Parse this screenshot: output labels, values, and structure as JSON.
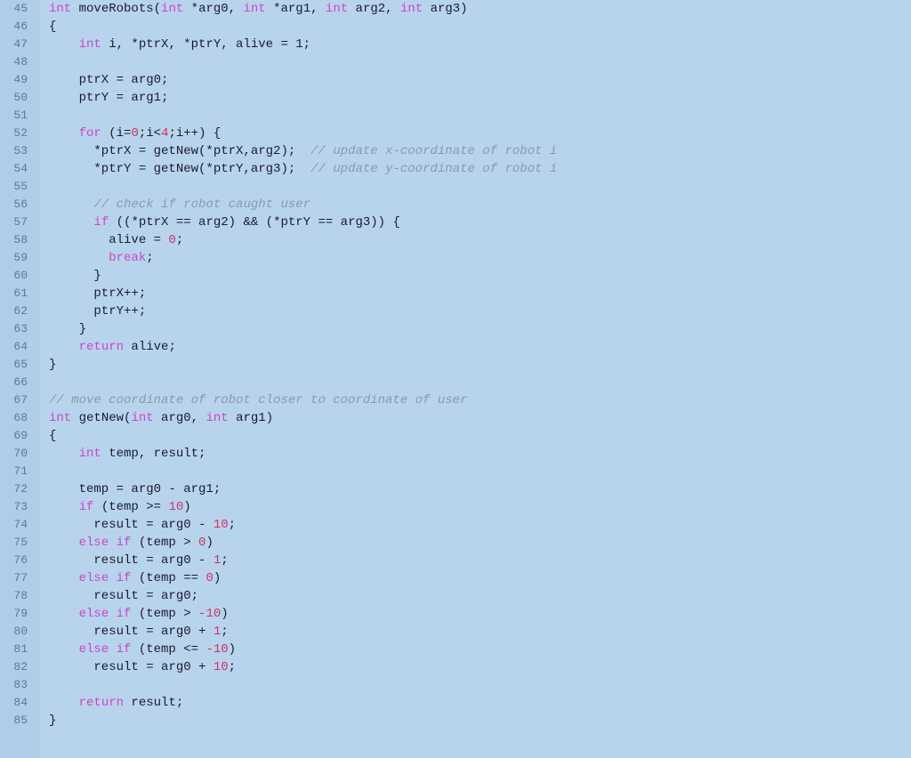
{
  "editor": {
    "background": "#b8d4ed",
    "lines": [
      {
        "num": 45,
        "tokens": [
          {
            "t": "kw",
            "v": "int"
          },
          {
            "t": "plain",
            "v": " moveRobots("
          },
          {
            "t": "kw",
            "v": "int"
          },
          {
            "t": "plain",
            "v": " *arg0, "
          },
          {
            "t": "kw",
            "v": "int"
          },
          {
            "t": "plain",
            "v": " *arg1, "
          },
          {
            "t": "kw",
            "v": "int"
          },
          {
            "t": "plain",
            "v": " arg2, "
          },
          {
            "t": "kw",
            "v": "int"
          },
          {
            "t": "plain",
            "v": " arg3)"
          }
        ]
      },
      {
        "num": 46,
        "tokens": [
          {
            "t": "plain",
            "v": "{"
          }
        ]
      },
      {
        "num": 47,
        "tokens": [
          {
            "t": "plain",
            "v": "    "
          },
          {
            "t": "kw",
            "v": "int"
          },
          {
            "t": "plain",
            "v": " i, *ptrX, *ptrY, alive = 1;"
          }
        ]
      },
      {
        "num": 48,
        "tokens": []
      },
      {
        "num": 49,
        "tokens": [
          {
            "t": "plain",
            "v": "    ptrX = arg0;"
          }
        ]
      },
      {
        "num": 50,
        "tokens": [
          {
            "t": "plain",
            "v": "    ptrY = arg1;"
          }
        ]
      },
      {
        "num": 51,
        "tokens": []
      },
      {
        "num": 52,
        "tokens": [
          {
            "t": "plain",
            "v": "    "
          },
          {
            "t": "kw",
            "v": "for"
          },
          {
            "t": "plain",
            "v": " (i="
          },
          {
            "t": "num",
            "v": "0"
          },
          {
            "t": "plain",
            "v": ";i<"
          },
          {
            "t": "num",
            "v": "4"
          },
          {
            "t": "plain",
            "v": ";i++) {"
          }
        ]
      },
      {
        "num": 53,
        "tokens": [
          {
            "t": "plain",
            "v": "      *ptrX = getNew(*ptrX,arg2);  "
          },
          {
            "t": "cm",
            "v": "// update x-coordinate of robot i"
          }
        ]
      },
      {
        "num": 54,
        "tokens": [
          {
            "t": "plain",
            "v": "      *ptrY = getNew(*ptrY,arg3);  "
          },
          {
            "t": "cm",
            "v": "// update y-coordinate of robot i"
          }
        ]
      },
      {
        "num": 55,
        "tokens": []
      },
      {
        "num": 56,
        "tokens": [
          {
            "t": "plain",
            "v": "      "
          },
          {
            "t": "cm",
            "v": "// check if robot caught user"
          }
        ]
      },
      {
        "num": 57,
        "tokens": [
          {
            "t": "plain",
            "v": "      "
          },
          {
            "t": "kw",
            "v": "if"
          },
          {
            "t": "plain",
            "v": " ((*ptrX == arg2) && (*ptrY == arg3)) {"
          }
        ]
      },
      {
        "num": 58,
        "tokens": [
          {
            "t": "plain",
            "v": "        alive = "
          },
          {
            "t": "num",
            "v": "0"
          },
          {
            "t": "plain",
            "v": ";"
          }
        ]
      },
      {
        "num": 59,
        "tokens": [
          {
            "t": "plain",
            "v": "        "
          },
          {
            "t": "kw",
            "v": "break"
          },
          {
            "t": "plain",
            "v": ";"
          }
        ]
      },
      {
        "num": 60,
        "tokens": [
          {
            "t": "plain",
            "v": "      }"
          }
        ]
      },
      {
        "num": 61,
        "tokens": [
          {
            "t": "plain",
            "v": "      ptrX++;"
          }
        ]
      },
      {
        "num": 62,
        "tokens": [
          {
            "t": "plain",
            "v": "      ptrY++;"
          }
        ]
      },
      {
        "num": 63,
        "tokens": [
          {
            "t": "plain",
            "v": "    }"
          }
        ]
      },
      {
        "num": 64,
        "tokens": [
          {
            "t": "plain",
            "v": "    "
          },
          {
            "t": "kw",
            "v": "return"
          },
          {
            "t": "plain",
            "v": " alive;"
          }
        ]
      },
      {
        "num": 65,
        "tokens": [
          {
            "t": "plain",
            "v": "}"
          }
        ]
      },
      {
        "num": 66,
        "tokens": []
      },
      {
        "num": 67,
        "tokens": [
          {
            "t": "cm",
            "v": "// move coordinate of robot closer to coordinate of user"
          }
        ]
      },
      {
        "num": 68,
        "tokens": [
          {
            "t": "kw",
            "v": "int"
          },
          {
            "t": "plain",
            "v": " getNew("
          },
          {
            "t": "kw",
            "v": "int"
          },
          {
            "t": "plain",
            "v": " arg0, "
          },
          {
            "t": "kw",
            "v": "int"
          },
          {
            "t": "plain",
            "v": " arg1)"
          }
        ]
      },
      {
        "num": 69,
        "tokens": [
          {
            "t": "plain",
            "v": "{"
          }
        ]
      },
      {
        "num": 70,
        "tokens": [
          {
            "t": "plain",
            "v": "    "
          },
          {
            "t": "kw",
            "v": "int"
          },
          {
            "t": "plain",
            "v": " temp, result;"
          }
        ]
      },
      {
        "num": 71,
        "tokens": []
      },
      {
        "num": 72,
        "tokens": [
          {
            "t": "plain",
            "v": "    temp = arg0 - arg1;"
          }
        ]
      },
      {
        "num": 73,
        "tokens": [
          {
            "t": "plain",
            "v": "    "
          },
          {
            "t": "kw",
            "v": "if"
          },
          {
            "t": "plain",
            "v": " (temp >= "
          },
          {
            "t": "num",
            "v": "10"
          },
          {
            "t": "plain",
            "v": ")"
          }
        ]
      },
      {
        "num": 74,
        "tokens": [
          {
            "t": "plain",
            "v": "      result = arg0 - "
          },
          {
            "t": "num",
            "v": "10"
          },
          {
            "t": "plain",
            "v": ";"
          }
        ]
      },
      {
        "num": 75,
        "tokens": [
          {
            "t": "plain",
            "v": "    "
          },
          {
            "t": "kw",
            "v": "else if"
          },
          {
            "t": "plain",
            "v": " (temp > "
          },
          {
            "t": "num",
            "v": "0"
          },
          {
            "t": "plain",
            "v": ")"
          }
        ]
      },
      {
        "num": 76,
        "tokens": [
          {
            "t": "plain",
            "v": "      result = arg0 - "
          },
          {
            "t": "num",
            "v": "1"
          },
          {
            "t": "plain",
            "v": ";"
          }
        ]
      },
      {
        "num": 77,
        "tokens": [
          {
            "t": "plain",
            "v": "    "
          },
          {
            "t": "kw",
            "v": "else if"
          },
          {
            "t": "plain",
            "v": " (temp == "
          },
          {
            "t": "num",
            "v": "0"
          },
          {
            "t": "plain",
            "v": ")"
          }
        ]
      },
      {
        "num": 78,
        "tokens": [
          {
            "t": "plain",
            "v": "      result = arg0;"
          }
        ]
      },
      {
        "num": 79,
        "tokens": [
          {
            "t": "plain",
            "v": "    "
          },
          {
            "t": "kw",
            "v": "else if"
          },
          {
            "t": "plain",
            "v": " (temp > "
          },
          {
            "t": "num",
            "v": "-10"
          },
          {
            "t": "plain",
            "v": ")"
          }
        ]
      },
      {
        "num": 80,
        "tokens": [
          {
            "t": "plain",
            "v": "      result = arg0 + "
          },
          {
            "t": "num",
            "v": "1"
          },
          {
            "t": "plain",
            "v": ";"
          }
        ]
      },
      {
        "num": 81,
        "tokens": [
          {
            "t": "plain",
            "v": "    "
          },
          {
            "t": "kw",
            "v": "else if"
          },
          {
            "t": "plain",
            "v": " (temp <= "
          },
          {
            "t": "num",
            "v": "-10"
          },
          {
            "t": "plain",
            "v": ")"
          }
        ]
      },
      {
        "num": 82,
        "tokens": [
          {
            "t": "plain",
            "v": "      result = arg0 + "
          },
          {
            "t": "num",
            "v": "10"
          },
          {
            "t": "plain",
            "v": ";"
          }
        ]
      },
      {
        "num": 83,
        "tokens": []
      },
      {
        "num": 84,
        "tokens": [
          {
            "t": "plain",
            "v": "    "
          },
          {
            "t": "kw",
            "v": "return"
          },
          {
            "t": "plain",
            "v": " result;"
          }
        ]
      },
      {
        "num": 85,
        "tokens": [
          {
            "t": "plain",
            "v": "}"
          }
        ]
      }
    ]
  }
}
